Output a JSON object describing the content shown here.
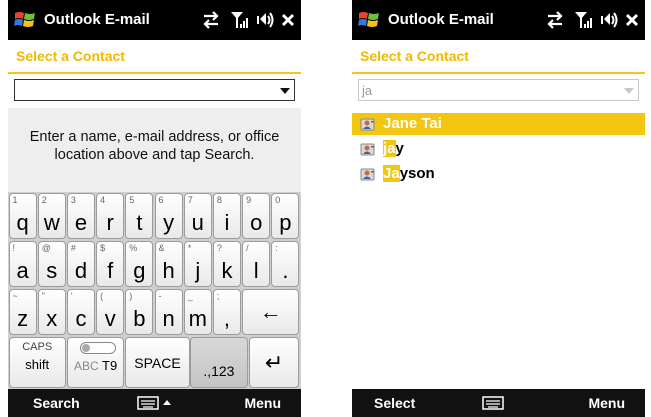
{
  "left_screen": {
    "title": "Outlook E-mail",
    "select_label": "Select a Contact",
    "combo_value": "",
    "hint": "Enter a name, e-mail address, or office location above and tap Search.",
    "keyboard": {
      "row1": [
        [
          "1",
          "q"
        ],
        [
          "2",
          "w"
        ],
        [
          "3",
          "e"
        ],
        [
          "4",
          "r"
        ],
        [
          "5",
          "t"
        ],
        [
          "6",
          "y"
        ],
        [
          "7",
          "u"
        ],
        [
          "8",
          "i"
        ],
        [
          "9",
          "o"
        ],
        [
          "0",
          "p"
        ]
      ],
      "row2": [
        [
          "!",
          "a"
        ],
        [
          "@",
          "s"
        ],
        [
          "#",
          "d"
        ],
        [
          "$",
          "f"
        ],
        [
          "%",
          "g"
        ],
        [
          "&",
          "h"
        ],
        [
          "*",
          "j"
        ],
        [
          "?",
          "k"
        ],
        [
          "/",
          "l"
        ],
        [
          ":",
          "."
        ]
      ],
      "row3": [
        [
          "~",
          "z"
        ],
        [
          "\"",
          "x"
        ],
        [
          "'",
          "c"
        ],
        [
          "(",
          "v"
        ],
        [
          ")",
          "b"
        ],
        [
          "-",
          "n"
        ],
        [
          "_",
          "m"
        ],
        [
          ";",
          ","
        ]
      ],
      "backspace": "←",
      "caps_top": "CAPS",
      "caps_bottom": "shift",
      "abc": "ABC",
      "t9": "T9",
      "space": "SPACE",
      "numbers": ".,123",
      "enter": "↵"
    },
    "softkeys": {
      "left": "Search",
      "right": "Menu"
    }
  },
  "right_screen": {
    "title": "Outlook E-mail",
    "select_label": "Select a Contact",
    "combo_value": "ja",
    "contacts": [
      {
        "match": "Ja",
        "rest": "ne Tai",
        "selected": true
      },
      {
        "match": "ja",
        "rest": "y",
        "selected": false
      },
      {
        "match": "Ja",
        "rest": "yson",
        "selected": false
      }
    ],
    "softkeys": {
      "left": "Select",
      "right": "Menu"
    }
  },
  "icons": [
    "windows-logo-icon",
    "sync-icon",
    "signal-icon",
    "volume-icon",
    "close-icon",
    "keyboard-icon",
    "contact-card-icon"
  ],
  "colors": {
    "accent": "#f3c612",
    "titlebar": "#000000"
  }
}
